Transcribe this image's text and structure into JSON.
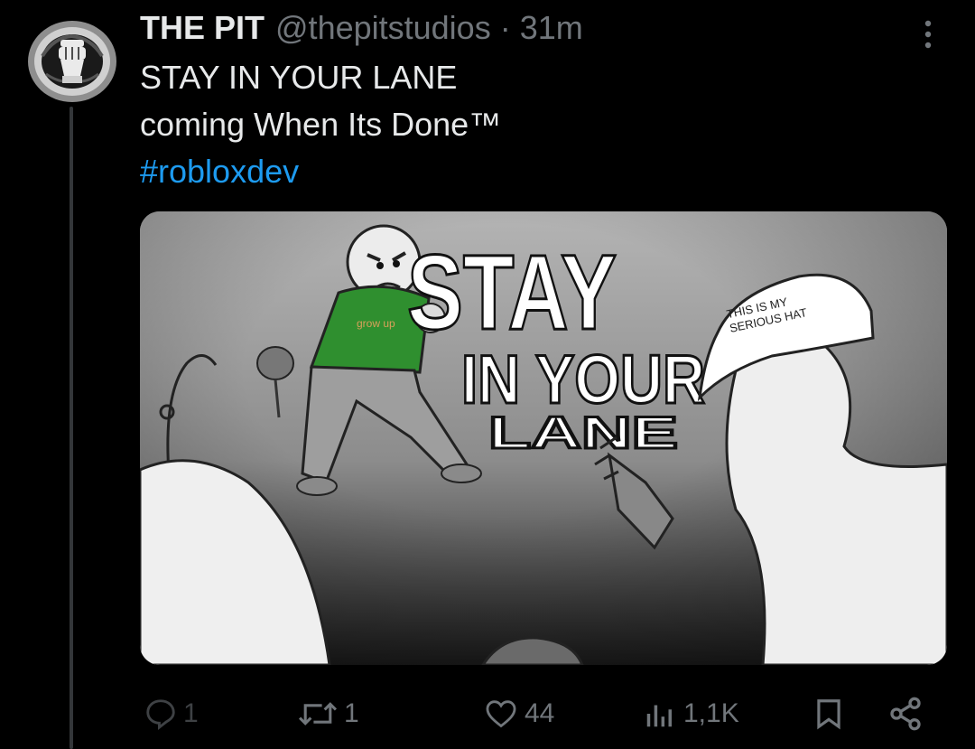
{
  "post": {
    "author_name": "THE PIT",
    "handle": "@thepitstudios",
    "separator": "·",
    "time": "31m",
    "lines": [
      "STAY IN YOUR LANE",
      "coming When Its Done™"
    ],
    "hashtag": "#robloxdev"
  },
  "media": {
    "art_text": [
      "STAY",
      "IN YOUR",
      "LANE"
    ],
    "hat_text": [
      "THIS IS MY",
      "SERIOUS HAT"
    ]
  },
  "actions": {
    "replies": "1",
    "reposts": "1",
    "likes": "44",
    "views": "1,1K"
  },
  "colors": {
    "background": "#000000",
    "text": "#e7e9ea",
    "muted": "#71767b",
    "link": "#1d9bf0",
    "shirt_green": "#2f8f2f"
  },
  "icons": [
    "avatar-fist-icon",
    "more-icon",
    "reply-icon",
    "repost-icon",
    "like-icon",
    "views-icon",
    "bookmark-icon",
    "share-icon"
  ]
}
